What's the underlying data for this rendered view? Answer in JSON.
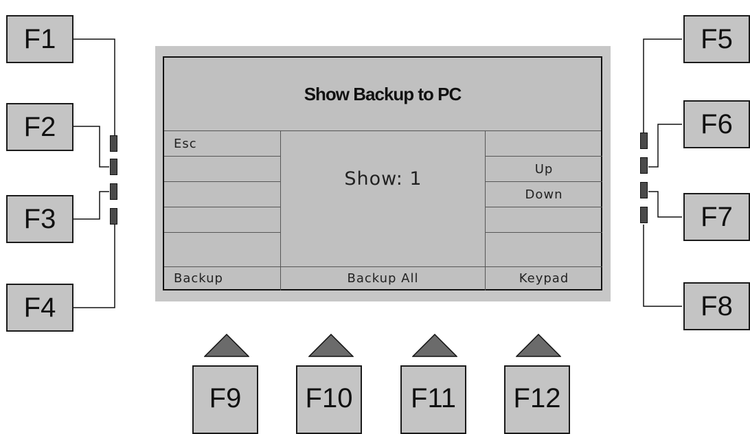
{
  "screen": {
    "title": "Show Backup to PC",
    "center_text": "Show: 1",
    "left_softkeys": [
      "Esc",
      "",
      "",
      "",
      ""
    ],
    "right_softkeys": [
      "",
      "Up",
      "Down",
      "",
      ""
    ],
    "bottom": {
      "left": "Backup",
      "middle": "Backup All",
      "right": "Keypad"
    }
  },
  "function_keys": {
    "left": [
      "F1",
      "F2",
      "F3",
      "F4"
    ],
    "right": [
      "F5",
      "F6",
      "F7",
      "F8"
    ],
    "bottom": [
      "F9",
      "F10",
      "F11",
      "F12"
    ]
  },
  "colors": {
    "key_fill": "#c4c4c4",
    "lcd_fill": "#c0c0c0",
    "bezel_fill": "#c7c7c7",
    "arrow_fill": "#6b6b6b",
    "led_fill": "#4a4a4a"
  }
}
